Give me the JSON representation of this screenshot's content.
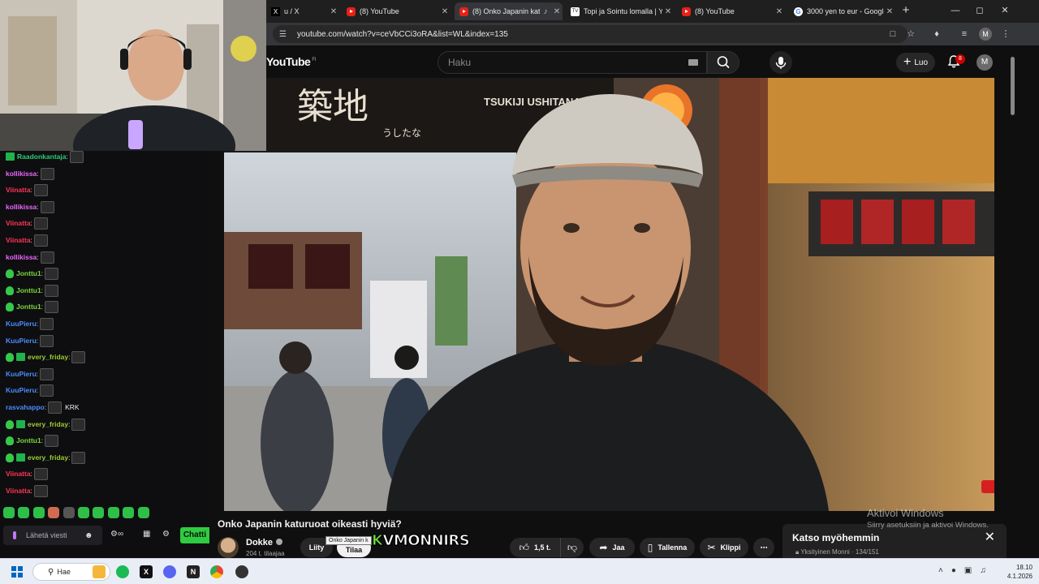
{
  "browser": {
    "tabs": [
      {
        "title": "u / X",
        "favicon": "x-icon",
        "active": false
      },
      {
        "title": "(8) YouTube",
        "favicon": "youtube-icon",
        "active": false
      },
      {
        "title": "(8) Onko Japanin katu",
        "favicon": "youtube-icon",
        "active": true,
        "audio": true
      },
      {
        "title": "Topi ja Sointu lomalla | Yl",
        "favicon": "tv-icon",
        "active": false
      },
      {
        "title": "(8) YouTube",
        "favicon": "youtube-icon",
        "active": false
      },
      {
        "title": "3000 yen to eur - Google",
        "favicon": "google-icon",
        "active": false
      }
    ],
    "url": "youtube.com/watch?v=ceVbCCi3oRA&list=WL&index=135",
    "profile_initial": "M"
  },
  "youtube": {
    "logo": "YouTube",
    "region": "FI",
    "search_placeholder": "Haku",
    "create_label": "Luo",
    "notification_count": "8",
    "avatar_initial": "M",
    "video": {
      "title": "Onko Japanin katuruoat oikeasti hyviä?",
      "channel": "Dokke",
      "subscribers": "204 t. tilaajaa",
      "join_label": "Liity",
      "subscribe_label": "Tilaa",
      "tooltip": "Onko Japanin k",
      "overlay_logo_k": "K",
      "overlay_logo_rest": "VMONNIRS",
      "likes": "1,5 t.",
      "share_label": "Jaa",
      "save_label": "Tallenna",
      "clip_label": "Klippi",
      "sign_left": "築地",
      "sign_text": "TSUKIJI USHITANA",
      "sign_small": "うしたな"
    },
    "watch_later": {
      "title": "Katso myöhemmin",
      "subtitle": "Yksityinen Monni · 134/151"
    }
  },
  "activate_windows": {
    "title": "Aktivoi Windows",
    "subtitle": "Siirry asetuksiin ja aktivoi Windows."
  },
  "chat": {
    "messages": [
      {
        "user": "Raadonkantaja",
        "color": "#2ecc71",
        "badges": [
          "gift"
        ],
        "text": ""
      },
      {
        "user": "kollikissa",
        "color": "#ee66ff",
        "badges": [],
        "text": ""
      },
      {
        "user": "Viinatta",
        "color": "#ff3355",
        "badges": [],
        "text": ""
      },
      {
        "user": "kollikissa",
        "color": "#ee66ff",
        "badges": [],
        "text": ""
      },
      {
        "user": "Viinatta",
        "color": "#ff3355",
        "badges": [],
        "text": ""
      },
      {
        "user": "Viinatta",
        "color": "#ff3355",
        "badges": [],
        "text": ""
      },
      {
        "user": "kollikissa",
        "color": "#ee66ff",
        "badges": [],
        "text": ""
      },
      {
        "user": "Jonttu1",
        "color": "#7ad63f",
        "badges": [
          "sub"
        ],
        "text": ""
      },
      {
        "user": "Jonttu1",
        "color": "#7ad63f",
        "badges": [
          "sub"
        ],
        "text": ""
      },
      {
        "user": "Jonttu1",
        "color": "#7ad63f",
        "badges": [
          "sub"
        ],
        "text": ""
      },
      {
        "user": "KuuPieru",
        "color": "#4a8cff",
        "badges": [],
        "text": ""
      },
      {
        "user": "KuuPieru",
        "color": "#4a8cff",
        "badges": [],
        "text": ""
      },
      {
        "user": "every_friday",
        "color": "#9acd32",
        "badges": [
          "sub",
          "gift"
        ],
        "text": ""
      },
      {
        "user": "KuuPieru",
        "color": "#4a8cff",
        "badges": [],
        "text": ""
      },
      {
        "user": "KuuPieru",
        "color": "#4a8cff",
        "badges": [],
        "text": ""
      },
      {
        "user": "rasvahappo",
        "color": "#4a8cff",
        "badges": [],
        "text": "KRK"
      },
      {
        "user": "every_friday",
        "color": "#9acd32",
        "badges": [
          "sub",
          "gift"
        ],
        "text": ""
      },
      {
        "user": "Jonttu1",
        "color": "#7ad63f",
        "badges": [
          "sub"
        ],
        "text": ""
      },
      {
        "user": "every_friday",
        "color": "#9acd32",
        "badges": [
          "sub",
          "gift"
        ],
        "text": ""
      },
      {
        "user": "Viinatta",
        "color": "#ff3355",
        "badges": [],
        "text": ""
      },
      {
        "user": "Viinatta",
        "color": "#ff3355",
        "badges": [],
        "text": ""
      }
    ],
    "input_placeholder": "Lähetä viesti",
    "chat_button": "Chatti"
  },
  "taskbar": {
    "search_label": "Hae",
    "time": "18.10",
    "date": "4.1.2026"
  }
}
